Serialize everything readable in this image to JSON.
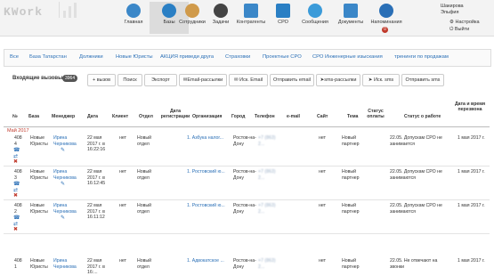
{
  "nav": {
    "logo": "KWork",
    "items": [
      {
        "label": "Главная",
        "icon": "home-icon",
        "color": "#3b87c8"
      },
      {
        "label": "Базы",
        "icon": "phone-icon",
        "color": "#2a7fc4"
      },
      {
        "label": "Сотрудники",
        "icon": "people-icon",
        "color": "#d09a4a"
      },
      {
        "label": "Задачи",
        "icon": "clock-icon",
        "color": "#444444"
      },
      {
        "label": "Контрагенты",
        "icon": "building-icon",
        "color": "#3b87c8"
      },
      {
        "label": "СРО",
        "icon": "monitor-icon",
        "color": "#2a7fc4"
      },
      {
        "label": "Сообщения",
        "icon": "chat-icon",
        "color": "#3b9bd9"
      },
      {
        "label": "Документы",
        "icon": "folder-icon",
        "color": "#3b87c8"
      },
      {
        "label": "Напоминания",
        "icon": "alarm-icon",
        "color": "#2a6fb6"
      }
    ],
    "reminder_count": "0",
    "user_name": "Шакирова",
    "user_first": "Эльфия",
    "settings_label": "Настройка",
    "logout_label": "Выйти"
  },
  "filters": [
    "Все",
    "База Татарстан",
    "Должники",
    "Новые Юристы",
    "АКЦИЯ приведи друга",
    "Страховки",
    "Проектные СРО",
    "СРО Инженерные изыскания",
    "тренинги по продажам"
  ],
  "toolbar": {
    "title": "Входящие вызовы",
    "count": "3964",
    "buttons": [
      "+ вызов",
      "Поиск",
      "Экспорт",
      "Email-рассылки",
      "Иск. Email",
      "Отправить email",
      "sms-рассылки",
      "Иск. sms",
      "Отправить sms"
    ]
  },
  "table": {
    "headers": [
      "№",
      "База",
      "Менеджер",
      "Дата",
      "Клиент",
      "Отдел",
      "Дата регистрации",
      "Организация",
      "Город",
      "Телефон",
      "e-mail",
      "Сайт",
      "Тема",
      "Статус оплаты",
      "Статус о работе",
      "Дата и время перезвона"
    ],
    "month": "Май 2017",
    "rows": [
      {
        "num": "408 4",
        "base": "Новые Юристы",
        "manager": "Ирина Черникова",
        "date": "22 мая 2017 г. в 16:22:16",
        "client": "нет",
        "dept": "Новый отдел",
        "org": "1. Азбука налог...",
        "city": "Ростов-на-Дону",
        "phone": "+7 (863) 2...",
        "site": "нет",
        "topic": "Новый партнер",
        "work_status": "22.05. Допускам СРО не занимается",
        "callback": "1 мая 2017 г."
      },
      {
        "num": "408 3",
        "base": "Новые Юристы",
        "manager": "Ирина Черникова",
        "date": "22 мая 2017 г. в 16:12:45",
        "client": "нет",
        "dept": "Новый отдел",
        "org": "1. Ростовский ю...",
        "city": "Ростов-на-Дону",
        "phone": "+7 (863) 2...",
        "site": "нет",
        "topic": "Новый партнер",
        "work_status": "22.05. Допускам СРО не занимаются",
        "callback": "1 мая 2017 г."
      },
      {
        "num": "408 2",
        "base": "Новые Юристы",
        "manager": "Ирина Черникова",
        "date": "22 мая 2017 г. в 16:11:12",
        "client": "нет",
        "dept": "Новый отдел",
        "org": "1. Ростовский ю...",
        "city": "Ростов-на-Дону",
        "phone": "+7 (863) 2...",
        "site": "нет",
        "topic": "Новый партнер",
        "work_status": "22.05. Допускам СРО не занимаются",
        "callback": "1 мая 2017 г."
      },
      {
        "num": "408 1",
        "base": "Новые Юристы",
        "manager": "Ирина Черникова",
        "date": "22 мая 2017 г. в 16:...",
        "client": "нет",
        "dept": "Новый отдел",
        "org": "1. Адвокатское ...",
        "city": "Ростов-на-Дону",
        "phone": "+7 (863) 2...",
        "site": "нет",
        "topic": "Новый партнер",
        "work_status": "22.05. Не отвечают на звонки",
        "callback": "1 мая 2017 г."
      }
    ]
  }
}
